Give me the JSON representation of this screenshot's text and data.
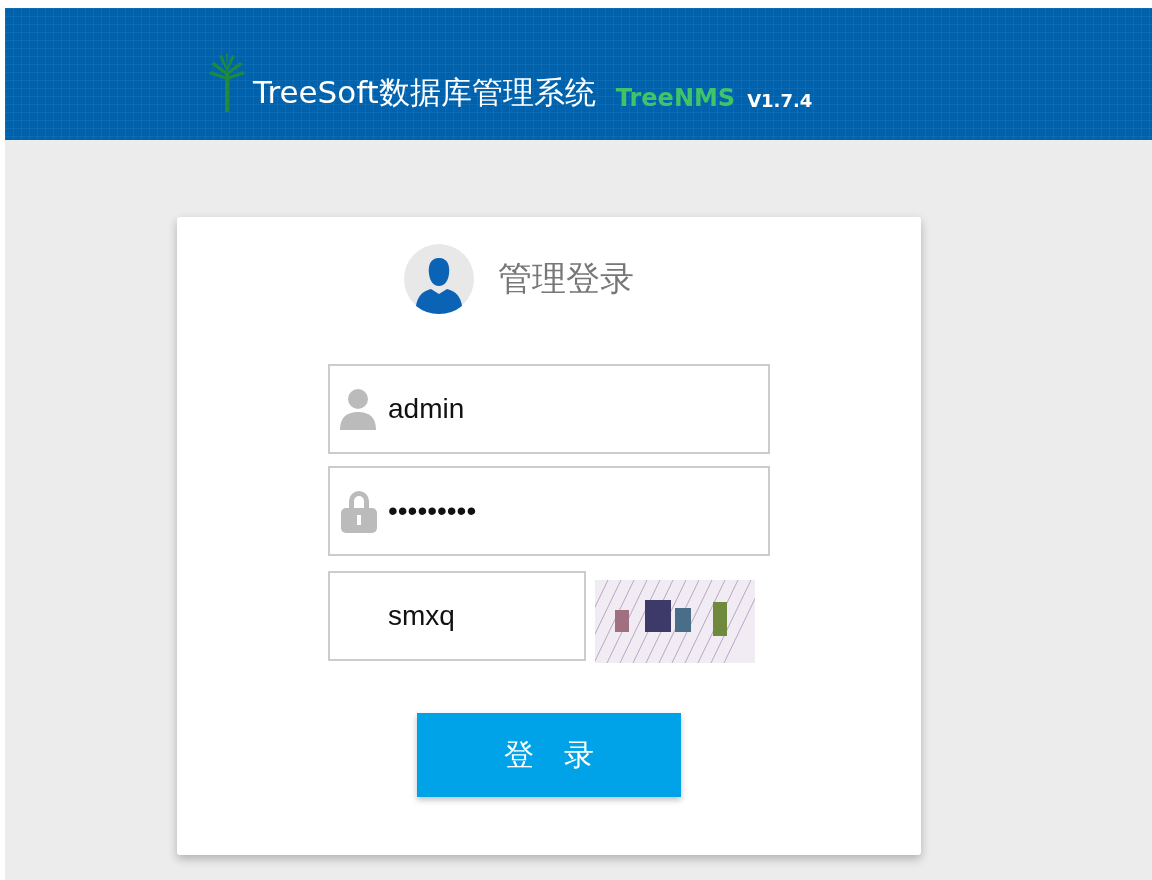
{
  "header": {
    "title": "TreeSoft数据库管理系统",
    "product": "TreeNMS",
    "version": "V1.7.4"
  },
  "login": {
    "heading": "管理登录",
    "fields": [
      {
        "kind": "user",
        "value": "admin"
      },
      {
        "kind": "lock",
        "value": "•••••••••"
      }
    ],
    "captcha": {
      "value": "smxq"
    },
    "submit": "登　录"
  }
}
